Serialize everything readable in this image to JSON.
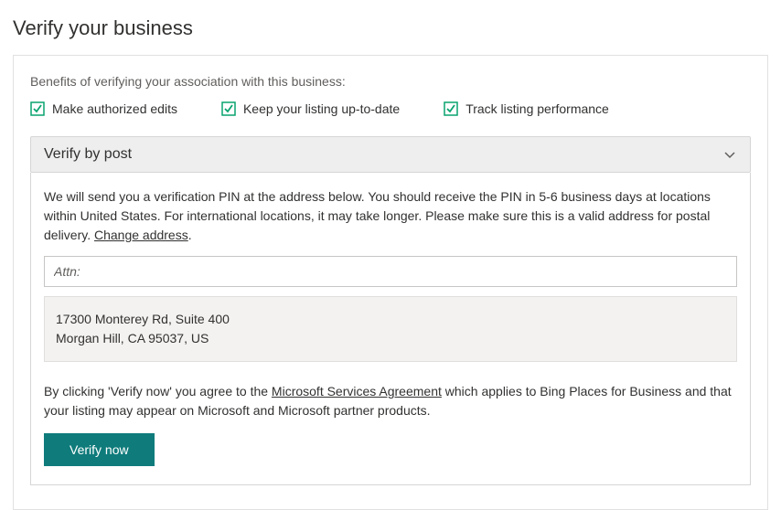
{
  "page": {
    "title": "Verify your business"
  },
  "benefits": {
    "label": "Benefits of verifying your association with this business:",
    "items": [
      "Make authorized edits",
      "Keep your listing up-to-date",
      "Track listing performance"
    ]
  },
  "accordion": {
    "title": "Verify by post"
  },
  "desc": {
    "text": "We will send you a verification PIN at the address below. You should receive the PIN in 5-6 business days at locations within United States. For international locations, it may take longer. Please make sure this is a valid address for postal delivery. ",
    "change_link": "Change address"
  },
  "attn": {
    "placeholder": "Attn:"
  },
  "address": {
    "line1": "17300 Monterey Rd, Suite 400",
    "line2": "Morgan Hill, CA 95037, US"
  },
  "agreement": {
    "pre": "By clicking 'Verify now' you agree to the ",
    "link": "Microsoft Services Agreement",
    "post": " which applies to Bing Places for Business and that your listing may appear on Microsoft and Microsoft partner products."
  },
  "buttons": {
    "verify": "Verify now"
  },
  "colors": {
    "accent": "#0f7b7b",
    "check": "#09a36f"
  }
}
